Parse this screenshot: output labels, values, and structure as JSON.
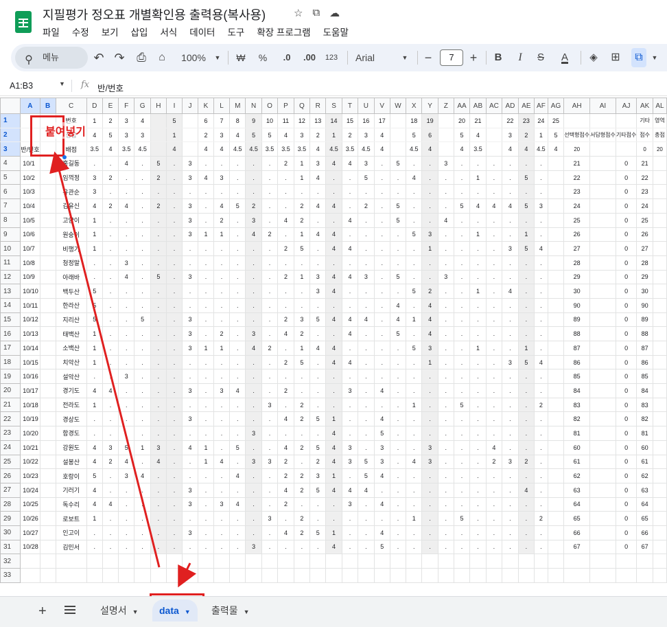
{
  "doc_title": "지필평가 정오표 개별확인용 출력용(복사용)",
  "menu": [
    "파일",
    "수정",
    "보기",
    "삽입",
    "서식",
    "데이터",
    "도구",
    "확장 프로그램",
    "도움말"
  ],
  "toolbar": {
    "search_label": "메뉴",
    "zoom": "100%",
    "currency": "₩",
    "percent": "%",
    "dec_decrease": ".0",
    "dec_increase": ".00",
    "number_format": "123",
    "font": "Arial",
    "font_size": "7",
    "minus": "−",
    "plus": "+",
    "bold": "B",
    "italic": "I",
    "strike": "S",
    "text_color": "A"
  },
  "formula_bar": {
    "name_box": "A1:B3",
    "fx": "fx",
    "value": "반/번호"
  },
  "columns": [
    "A",
    "B",
    "C",
    "D",
    "E",
    "F",
    "G",
    "H",
    "I",
    "J",
    "K",
    "L",
    "M",
    "N",
    "O",
    "P",
    "Q",
    "R",
    "S",
    "T",
    "U",
    "V",
    "W",
    "X",
    "Y",
    "Z",
    "AA",
    "AB",
    "AC",
    "AD",
    "AE",
    "AF",
    "AG",
    "AH",
    "AI",
    "AJ",
    "AK",
    "AL"
  ],
  "header_rows": {
    "r1": [
      "",
      "",
      "번호",
      "1",
      "2",
      "3",
      "4",
      "",
      "5",
      "",
      "6",
      "7",
      "8",
      "9",
      "10",
      "11",
      "12",
      "13",
      "14",
      "15",
      "16",
      "17",
      "",
      "18",
      "19",
      "",
      "20",
      "21",
      "",
      "22",
      "23",
      "24",
      "25",
      "",
      "",
      "",
      "기타",
      "영역"
    ],
    "r2": [
      "",
      "",
      "정답",
      "4",
      "5",
      "3",
      "3",
      "",
      "1",
      "",
      "2",
      "3",
      "4",
      "5",
      "5",
      "4",
      "3",
      "2",
      "1",
      "2",
      "3",
      "4",
      "",
      "5",
      "6",
      "",
      "5",
      "4",
      "",
      "3",
      "2",
      "1",
      "5",
      "선택형점수",
      "서답형점수",
      "기타점수",
      "점수",
      "총점"
    ],
    "r3": [
      "반/번호",
      "",
      "배점",
      "3.5",
      "4",
      "3.5",
      "4.5",
      "",
      "4",
      "",
      "4",
      "4",
      "4.5",
      "4.5",
      "3.5",
      "3.5",
      "3.5",
      "4",
      "4.5",
      "3.5",
      "4.5",
      "4",
      "",
      "4.5",
      "4",
      "",
      "4",
      "3.5",
      "",
      "4",
      "4",
      "4.5",
      "4",
      "20",
      "",
      "",
      "0",
      "20"
    ]
  },
  "rows": [
    {
      "n": "4",
      "c": [
        "10/1",
        "",
        "홍길동",
        ".",
        ".",
        "4",
        ".",
        "5",
        ".",
        "3",
        ".",
        ".",
        ".",
        ".",
        ".",
        "2",
        "1",
        "3",
        "4",
        "4",
        "3",
        ".",
        "5",
        ".",
        ".",
        "3",
        ".",
        ".",
        ".",
        ".",
        ".",
        ".",
        "",
        "21",
        "",
        "0",
        "21"
      ]
    },
    {
      "n": "5",
      "c": [
        "10/2",
        "",
        "임꺽정",
        "3",
        "2",
        ".",
        ".",
        "2",
        ".",
        "3",
        "4",
        "3",
        ".",
        ".",
        ".",
        ".",
        "1",
        "4",
        ".",
        ".",
        "5",
        ".",
        ".",
        "4",
        ".",
        ".",
        ".",
        "1",
        ".",
        ".",
        "5",
        ".",
        "",
        "22",
        "",
        "0",
        "22"
      ]
    },
    {
      "n": "6",
      "c": [
        "10/3",
        "",
        "유관순",
        "3",
        ".",
        ".",
        ".",
        ".",
        ".",
        ".",
        ".",
        ".",
        ".",
        ".",
        ".",
        ".",
        ".",
        ".",
        ".",
        ".",
        ".",
        ".",
        ".",
        ".",
        ".",
        ".",
        ".",
        ".",
        ".",
        ".",
        ".",
        ".",
        "",
        "23",
        "",
        "0",
        "23"
      ]
    },
    {
      "n": "7",
      "c": [
        "10/4",
        "",
        "김유신",
        "4",
        "2",
        "4",
        ".",
        "2",
        ".",
        "3",
        ".",
        "4",
        "5",
        "2",
        ".",
        ".",
        "2",
        "4",
        "4",
        ".",
        "2",
        ".",
        "5",
        ".",
        ".",
        ".",
        "5",
        "4",
        "4",
        "4",
        "5",
        "3",
        "",
        "24",
        "",
        "0",
        "24"
      ]
    },
    {
      "n": "8",
      "c": [
        "10/5",
        "",
        "고양이",
        "1",
        ".",
        ".",
        ".",
        ".",
        ".",
        "3",
        ".",
        "2",
        ".",
        "3",
        ".",
        "4",
        "2",
        ".",
        ".",
        "4",
        ".",
        ".",
        "5",
        ".",
        ".",
        "4",
        ".",
        ".",
        ".",
        ".",
        ".",
        ".",
        "",
        "25",
        "",
        "0",
        "25"
      ]
    },
    {
      "n": "9",
      "c": [
        "10/6",
        "",
        "원숭이",
        "1",
        ".",
        ".",
        ".",
        ".",
        ".",
        "3",
        "1",
        "1",
        ".",
        "4",
        "2",
        ".",
        "1",
        "4",
        "4",
        ".",
        ".",
        ".",
        ".",
        "5",
        "3",
        ".",
        ".",
        "1",
        ".",
        ".",
        "1",
        ".",
        "",
        "26",
        "",
        "0",
        "26"
      ]
    },
    {
      "n": "10",
      "c": [
        "10/7",
        "",
        "비행기",
        "1",
        ".",
        ".",
        ".",
        ".",
        ".",
        ".",
        ".",
        ".",
        ".",
        ".",
        ".",
        "2",
        "5",
        ".",
        "4",
        "4",
        ".",
        ".",
        ".",
        ".",
        "1",
        ".",
        ".",
        ".",
        ".",
        "3",
        "5",
        "4",
        "",
        "27",
        "",
        "0",
        "27"
      ]
    },
    {
      "n": "11",
      "c": [
        "10/8",
        "",
        "청정말",
        ".",
        ".",
        "3",
        ".",
        ".",
        ".",
        ".",
        ".",
        ".",
        ".",
        ".",
        ".",
        ".",
        ".",
        ".",
        ".",
        ".",
        ".",
        ".",
        ".",
        ".",
        ".",
        ".",
        ".",
        ".",
        ".",
        ".",
        ".",
        ".",
        "",
        "28",
        "",
        "0",
        "28"
      ]
    },
    {
      "n": "12",
      "c": [
        "10/9",
        "",
        "아래바",
        ".",
        ".",
        "4",
        ".",
        "5",
        ".",
        "3",
        ".",
        ".",
        ".",
        ".",
        ".",
        "2",
        "1",
        "3",
        "4",
        "4",
        "3",
        ".",
        "5",
        ".",
        ".",
        "3",
        ".",
        ".",
        ".",
        ".",
        ".",
        ".",
        "",
        "29",
        "",
        "0",
        "29"
      ]
    },
    {
      "n": "13",
      "c": [
        "10/10",
        "",
        "백두산",
        "5",
        ".",
        ".",
        ".",
        ".",
        ".",
        ".",
        ".",
        ".",
        ".",
        ".",
        ".",
        ".",
        ".",
        "3",
        "4",
        ".",
        ".",
        ".",
        ".",
        "5",
        "2",
        ".",
        ".",
        "1",
        ".",
        "4",
        ".",
        ".",
        "",
        "30",
        "",
        "0",
        "30"
      ]
    },
    {
      "n": "14",
      "c": [
        "10/11",
        "",
        "한라산",
        "5",
        ".",
        ".",
        ".",
        ".",
        ".",
        ".",
        ".",
        ".",
        ".",
        ".",
        ".",
        ".",
        ".",
        ".",
        ".",
        ".",
        ".",
        ".",
        "4",
        ".",
        "4",
        ".",
        ".",
        ".",
        ".",
        ".",
        ".",
        ".",
        "",
        "90",
        "",
        "0",
        "90"
      ]
    },
    {
      "n": "15",
      "c": [
        "10/12",
        "",
        "지리산",
        "5",
        ".",
        ".",
        "5",
        ".",
        ".",
        "3",
        ".",
        ".",
        ".",
        ".",
        ".",
        "2",
        "3",
        "5",
        "4",
        "4",
        "4",
        ".",
        "4",
        "1",
        "4",
        ".",
        ".",
        ".",
        ".",
        ".",
        ".",
        ".",
        "",
        "89",
        "",
        "0",
        "89"
      ]
    },
    {
      "n": "16",
      "c": [
        "10/13",
        "",
        "태백산",
        "1",
        ".",
        ".",
        ".",
        ".",
        ".",
        "3",
        ".",
        "2",
        ".",
        "3",
        ".",
        "4",
        "2",
        ".",
        ".",
        "4",
        ".",
        ".",
        "5",
        ".",
        "4",
        ".",
        ".",
        ".",
        ".",
        ".",
        ".",
        ".",
        "",
        "88",
        "",
        "0",
        "88"
      ]
    },
    {
      "n": "17",
      "c": [
        "10/14",
        "",
        "소백산",
        "1",
        ".",
        ".",
        ".",
        ".",
        ".",
        "3",
        "1",
        "1",
        ".",
        "4",
        "2",
        ".",
        "1",
        "4",
        "4",
        ".",
        ".",
        ".",
        ".",
        "5",
        "3",
        ".",
        ".",
        "1",
        ".",
        ".",
        "1",
        ".",
        "",
        "87",
        "",
        "0",
        "87"
      ]
    },
    {
      "n": "18",
      "c": [
        "10/15",
        "",
        "치악산",
        "1",
        ".",
        ".",
        ".",
        ".",
        ".",
        ".",
        ".",
        ".",
        ".",
        ".",
        ".",
        "2",
        "5",
        ".",
        "4",
        "4",
        ".",
        ".",
        ".",
        ".",
        "1",
        ".",
        ".",
        ".",
        ".",
        "3",
        "5",
        "4",
        "",
        "86",
        "",
        "0",
        "86"
      ]
    },
    {
      "n": "19",
      "c": [
        "10/16",
        "",
        "설악산",
        ".",
        ".",
        "3",
        ".",
        ".",
        ".",
        ".",
        ".",
        ".",
        ".",
        ".",
        ".",
        ".",
        ".",
        ".",
        ".",
        ".",
        ".",
        ".",
        ".",
        ".",
        ".",
        ".",
        ".",
        ".",
        ".",
        ".",
        ".",
        ".",
        "",
        "85",
        "",
        "0",
        "85"
      ]
    },
    {
      "n": "20",
      "c": [
        "10/17",
        "",
        "경기도",
        "4",
        "4",
        ".",
        ".",
        ".",
        ".",
        "3",
        ".",
        "3",
        "4",
        ".",
        ".",
        "2",
        ".",
        ".",
        ".",
        "3",
        ".",
        "4",
        ".",
        ".",
        ".",
        ".",
        ".",
        ".",
        ".",
        ".",
        ".",
        ".",
        "",
        "84",
        "",
        "0",
        "84"
      ]
    },
    {
      "n": "21",
      "c": [
        "10/18",
        "",
        "전라도",
        "1",
        ".",
        ".",
        ".",
        ".",
        ".",
        ".",
        ".",
        ".",
        ".",
        ".",
        "3",
        ".",
        "2",
        ".",
        ".",
        ".",
        ".",
        ".",
        ".",
        "1",
        ".",
        ".",
        "5",
        ".",
        ".",
        ".",
        ".",
        "2",
        "",
        "83",
        "",
        "0",
        "83"
      ]
    },
    {
      "n": "22",
      "c": [
        "10/19",
        "",
        "경상도",
        ".",
        ".",
        ".",
        ".",
        ".",
        ".",
        "3",
        ".",
        ".",
        ".",
        ".",
        ".",
        "4",
        "2",
        "5",
        "1",
        ".",
        ".",
        "4",
        ".",
        ".",
        ".",
        ".",
        ".",
        ".",
        ".",
        ".",
        ".",
        ".",
        "",
        "82",
        "",
        "0",
        "82"
      ]
    },
    {
      "n": "23",
      "c": [
        "10/20",
        "",
        "함경도",
        ".",
        ".",
        ".",
        ".",
        ".",
        ".",
        ".",
        ".",
        ".",
        ".",
        "3",
        ".",
        ".",
        ".",
        ".",
        "4",
        ".",
        ".",
        "5",
        ".",
        ".",
        ".",
        ".",
        ".",
        ".",
        ".",
        ".",
        ".",
        ".",
        "",
        "81",
        "",
        "0",
        "81"
      ]
    },
    {
      "n": "24",
      "c": [
        "10/21",
        "",
        "강원도",
        "4",
        "3",
        "5",
        "1",
        "3",
        ".",
        "4",
        "1",
        ".",
        "5",
        ".",
        ".",
        "4",
        "2",
        "5",
        "4",
        "3",
        ".",
        "3",
        ".",
        ".",
        "3",
        ".",
        ".",
        ".",
        "4",
        ".",
        ".",
        ".",
        "",
        "60",
        "",
        "0",
        "60"
      ]
    },
    {
      "n": "25",
      "c": [
        "10/22",
        "",
        "설봉산",
        "4",
        "2",
        "4",
        ".",
        "4",
        ".",
        ".",
        "1",
        "4",
        ".",
        "3",
        "3",
        "2",
        ".",
        "2",
        "4",
        "3",
        "5",
        "3",
        ".",
        "4",
        "3",
        ".",
        ".",
        ".",
        "2",
        "3",
        "2",
        ".",
        "",
        "61",
        "",
        "0",
        "61"
      ]
    },
    {
      "n": "26",
      "c": [
        "10/23",
        "",
        "호랑이",
        "5",
        ".",
        "3",
        "4",
        ".",
        ".",
        ".",
        ".",
        ".",
        "4",
        ".",
        ".",
        "2",
        "2",
        "3",
        "1",
        ".",
        "5",
        "4",
        ".",
        ".",
        ".",
        ".",
        ".",
        ".",
        ".",
        ".",
        ".",
        ".",
        "",
        "62",
        "",
        "0",
        "62"
      ]
    },
    {
      "n": "27",
      "c": [
        "10/24",
        "",
        "기러기",
        "4",
        ".",
        ".",
        ".",
        ".",
        ".",
        "3",
        ".",
        ".",
        ".",
        ".",
        ".",
        "4",
        "2",
        "5",
        "4",
        "4",
        "4",
        ".",
        ".",
        ".",
        ".",
        ".",
        ".",
        ".",
        ".",
        ".",
        "4",
        ".",
        "",
        "63",
        "",
        "0",
        "63"
      ]
    },
    {
      "n": "28",
      "c": [
        "10/25",
        "",
        "독수리",
        "4",
        "4",
        ".",
        ".",
        ".",
        ".",
        "3",
        ".",
        "3",
        "4",
        ".",
        ".",
        "2",
        ".",
        ".",
        ".",
        "3",
        ".",
        "4",
        ".",
        ".",
        ".",
        ".",
        ".",
        ".",
        ".",
        ".",
        ".",
        ".",
        "",
        "64",
        "",
        "0",
        "64"
      ]
    },
    {
      "n": "29",
      "c": [
        "10/26",
        "",
        "로보트",
        "1",
        ".",
        ".",
        ".",
        ".",
        ".",
        ".",
        ".",
        ".",
        ".",
        ".",
        "3",
        ".",
        "2",
        ".",
        ".",
        ".",
        ".",
        ".",
        ".",
        "1",
        ".",
        ".",
        "5",
        ".",
        ".",
        ".",
        ".",
        "2",
        "",
        "65",
        "",
        "0",
        "65"
      ]
    },
    {
      "n": "30",
      "c": [
        "10/27",
        "",
        "인고이",
        ".",
        ".",
        ".",
        ".",
        ".",
        ".",
        "3",
        ".",
        ".",
        ".",
        ".",
        ".",
        "4",
        "2",
        "5",
        "1",
        ".",
        ".",
        "4",
        ".",
        ".",
        ".",
        ".",
        ".",
        ".",
        ".",
        ".",
        ".",
        ".",
        "",
        "66",
        "",
        "0",
        "66"
      ]
    },
    {
      "n": "31",
      "c": [
        "10/28",
        "",
        "김민서",
        ".",
        ".",
        ".",
        ".",
        ".",
        ".",
        ".",
        ".",
        ".",
        ".",
        "3",
        ".",
        ".",
        ".",
        ".",
        "4",
        ".",
        ".",
        "5",
        ".",
        ".",
        ".",
        ".",
        ".",
        ".",
        ".",
        ".",
        ".",
        ".",
        "",
        "67",
        "",
        "0",
        "67"
      ]
    },
    {
      "n": "32",
      "c": []
    },
    {
      "n": "33",
      "c": []
    }
  ],
  "row_numbers_header": [
    "1",
    "2",
    "3"
  ],
  "overlay": {
    "paste_label": "붙여넣기"
  },
  "sheet_tabs": [
    {
      "label": "설명서",
      "active": false
    },
    {
      "label": "data",
      "active": true
    },
    {
      "label": "출력물",
      "active": false
    }
  ]
}
